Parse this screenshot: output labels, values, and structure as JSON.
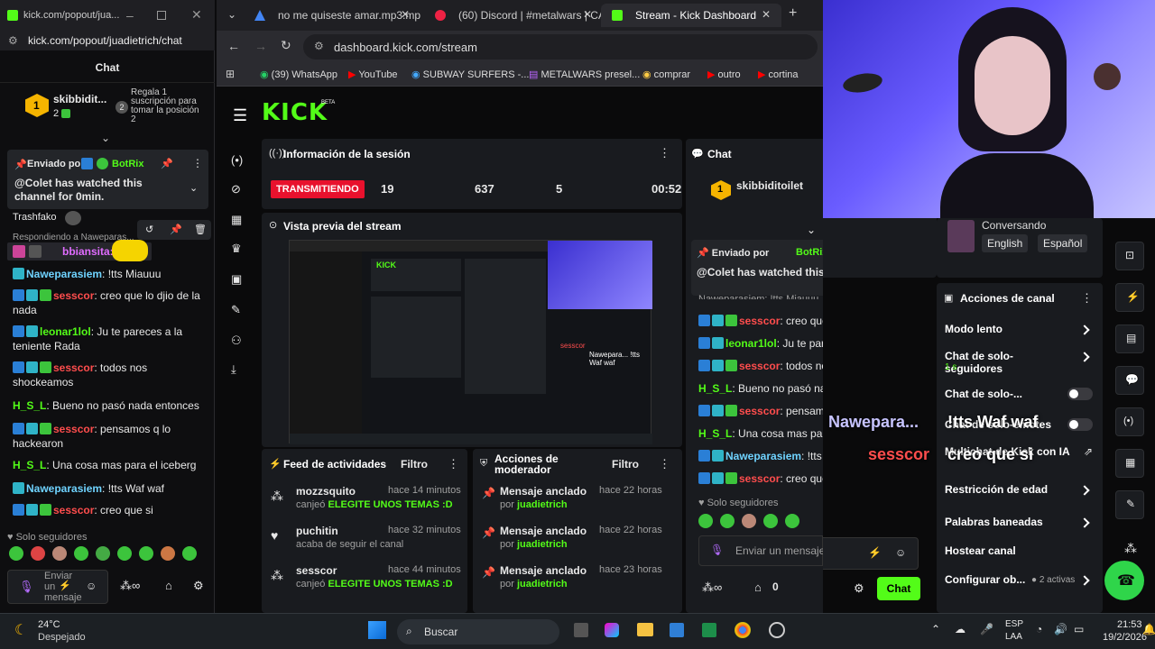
{
  "popout": {
    "window_title": "kick.com/popout/jua...",
    "url": "kick.com/popout/juadietrich/chat",
    "header": "Chat",
    "top_gifter": {
      "name": "skibbidit...",
      "rank": "1",
      "count": "2"
    },
    "gift_prompt": {
      "rank": "2",
      "text": "Regala 1 suscripción para tomar la posición 2"
    },
    "pinned": {
      "sent_by_label": "Enviado por",
      "bot": "BotRix",
      "message": "@Colet has watched this channel for 0min."
    },
    "partial_user": "Trashfako",
    "reply_label": "Respondiendo a Naweparas...",
    "reply_user": "bbiansita:",
    "messages": [
      {
        "user": "Naweparasiem",
        "text": ": !tts Miauuu",
        "color": "teal"
      },
      {
        "user": "sesscor",
        "text": ": creo que lo djio de la nada",
        "color": "red"
      },
      {
        "user": "leonar1lol",
        "text": ": Ju te pareces a la teniente Rada",
        "color": "green"
      },
      {
        "user": "sesscor",
        "text": ": todos nos shockeamos",
        "color": "red"
      },
      {
        "user": "H_S_L",
        "text": ": Bueno no pasó nada entonces",
        "color": "green"
      },
      {
        "user": "sesscor",
        "text": ": pensamos q lo hackearon",
        "color": "red"
      },
      {
        "user": "H_S_L",
        "text": ": Una cosa mas para el iceberg",
        "color": "green"
      },
      {
        "user": "Naweparasiem",
        "text": ": !tts Waf waf",
        "color": "teal"
      },
      {
        "user": "sesscor",
        "text": ": creo que si",
        "color": "red"
      }
    ],
    "followers_only": "Solo seguidores",
    "input_placeholder": "Enviar un mensaje"
  },
  "browser": {
    "tabs": [
      {
        "label": "no me quiseste amar.mp3.mpe"
      },
      {
        "label": "(60) Discord | #metalwars | CAL"
      },
      {
        "label": "Stream - Kick Dashboard"
      }
    ],
    "url": "dashboard.kick.com/stream",
    "bookmarks": [
      "(39) WhatsApp",
      "YouTube",
      "SUBWAY SURFERS -...",
      "METALWARS presel...",
      "comprar",
      "outro",
      "cortina"
    ]
  },
  "kick": {
    "logo": "KICK",
    "logo_beta": "BETA",
    "session": {
      "title": "Información de la sesión",
      "live_badge": "TRANSMITIENDO",
      "stats": [
        "19",
        "637",
        "5",
        "00:52"
      ]
    },
    "preview_title": "Vista previa del stream",
    "activity": {
      "title": "Feed de actividades",
      "filter": "Filtro",
      "items": [
        {
          "user": "mozzsquito",
          "time": "hace 14 minutos",
          "desc": "canjeó",
          "highlight": "ELEGITE UNOS TEMAS :D"
        },
        {
          "user": "puchitin",
          "time": "hace 32 minutos",
          "desc": "acaba de seguir el canal",
          "highlight": ""
        },
        {
          "user": "sesscor",
          "time": "hace 44 minutos",
          "desc": "canjeó",
          "highlight": "ELEGITE UNOS TEMAS :D"
        }
      ]
    },
    "modactions": {
      "title": "Acciones de moderador",
      "filter": "Filtro",
      "items": [
        {
          "action": "Mensaje anclado",
          "time": "hace 22 horas",
          "by": "por",
          "user": "juadietrich"
        },
        {
          "action": "Mensaje anclado",
          "time": "hace 22 horas",
          "by": "por",
          "user": "juadietrich"
        },
        {
          "action": "Mensaje anclado",
          "time": "hace 23 horas",
          "by": "por",
          "user": "juadietrich"
        }
      ]
    },
    "chat": {
      "title": "Chat",
      "top_gifter": "skibbiditoilet",
      "pinned_sent_by": "Enviado por",
      "pinned_bot": "BotRix",
      "pinned_message": "@Colet has watched this channel for 0min.",
      "partial": "Naweparasiem: !tts Miauuu",
      "messages": [
        {
          "user": "sesscor",
          "text": ": creo que lo djio de la nada",
          "color": "red"
        },
        {
          "user": "leonar1lol",
          "text": ": Ju te pareces a la teniente Rada",
          "color": "green"
        },
        {
          "user": "sesscor",
          "text": ": todos nos shockeamos",
          "color": "red"
        },
        {
          "user": "H_S_L",
          "text": ": Bueno no pasó nada entonces",
          "color": "green"
        },
        {
          "user": "sesscor",
          "text": ": pensamos q lo hackearon",
          "color": "red"
        },
        {
          "user": "H_S_L",
          "text": ": Una cosa mas para el iceberg",
          "color": "green"
        },
        {
          "user": "Naweparasiem",
          "text": ": !tts Waf waf",
          "color": "teal"
        },
        {
          "user": "sesscor",
          "text": ": creo que si",
          "color": "red"
        }
      ],
      "followers_only": "Solo seguidores",
      "input_placeholder": "Enviar un mensaje",
      "kicks_count": "0",
      "send_button": "Chat"
    }
  },
  "overlay": {
    "user1": "Nawepara...",
    "msg1": "!tts Waf waf",
    "user2": "sesscor",
    "msg2": "creo que si"
  },
  "right_panel": {
    "stream_category": "Conversando",
    "lang_tags": [
      "English",
      "Español"
    ],
    "channel_actions": {
      "title": "Acciones de canal",
      "items": [
        {
          "label": "Modo lento",
          "sub": "",
          "control": "chevron"
        },
        {
          "label": "Chat de solo-seguidores",
          "sub": "1 s",
          "control": "chevron"
        },
        {
          "label": "Chat de solo-...",
          "sub": "",
          "control": "toggle"
        },
        {
          "label": "Chat de solo-emotes",
          "sub": "",
          "control": "toggle"
        },
        {
          "label": "Multichat de Kick con IA",
          "sub": "",
          "control": "external"
        },
        {
          "label": "Restricción de edad",
          "sub": "",
          "control": "chevron"
        },
        {
          "label": "Palabras baneadas",
          "sub": "",
          "control": "chevron"
        },
        {
          "label": "Hostear canal",
          "sub": "",
          "control": "none"
        },
        {
          "label": "Configurar ob...",
          "sub": "2 activas",
          "control": "chevron"
        }
      ]
    }
  },
  "taskbar": {
    "temp": "24°C",
    "weather": "Despejado",
    "search": "Buscar",
    "lang1": "ESP",
    "lang2": "LAA",
    "time": "21:53",
    "date": "19/2/2026"
  },
  "colors": {
    "kick_green": "#53fc18",
    "live_red": "#e8112d",
    "username_red": "#ff4d4d",
    "username_teal": "#6fd3ff"
  }
}
